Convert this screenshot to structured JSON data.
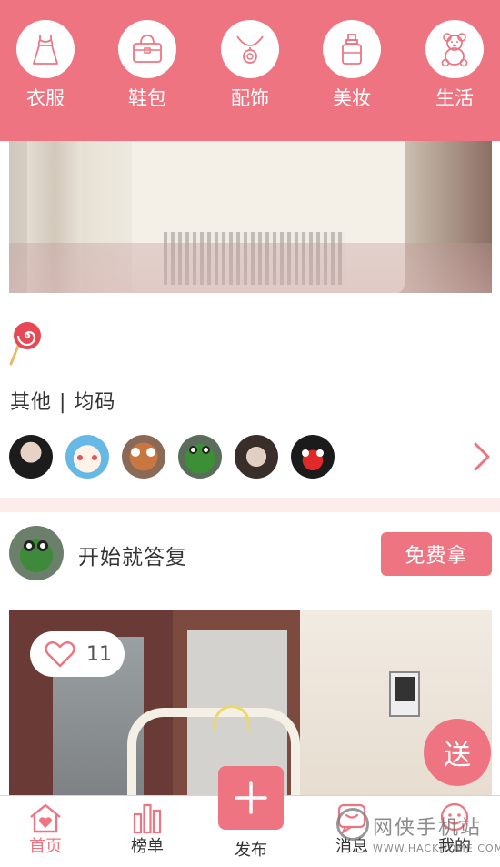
{
  "theme": {
    "accent": "#ef7481",
    "divider": "#fdecec"
  },
  "categories": [
    {
      "label": "衣服",
      "icon": "dress-icon"
    },
    {
      "label": "鞋包",
      "icon": "handbag-icon"
    },
    {
      "label": "配饰",
      "icon": "necklace-icon"
    },
    {
      "label": "美妆",
      "icon": "perfume-icon"
    },
    {
      "label": "生活",
      "icon": "teddy-bear-icon"
    }
  ],
  "item1": {
    "tag_icon": "lollipop-icon",
    "meta": "其他 | 均码",
    "avatar_count": 6
  },
  "post2": {
    "user_name": "开始就答复",
    "free_button": "免费拿",
    "likes": "11"
  },
  "send_button": "送",
  "tabs": [
    {
      "label": "首页",
      "icon": "home-heart-icon",
      "active": true
    },
    {
      "label": "榜单",
      "icon": "bar-chart-icon",
      "active": false
    },
    {
      "label": "发布",
      "icon": "plus-icon",
      "active": false
    },
    {
      "label": "消息",
      "icon": "message-icon",
      "active": false
    },
    {
      "label": "我的",
      "icon": "profile-icon",
      "active": false
    }
  ],
  "watermark": {
    "text": "网侠手机站",
    "url": "WWW.HACKHOME.COM"
  }
}
